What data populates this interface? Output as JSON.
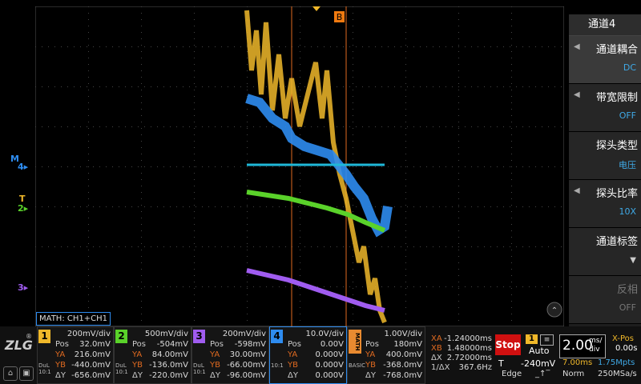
{
  "panel": {
    "title": "通道4",
    "items": [
      {
        "label": "通道耦合",
        "value": "DC",
        "selected": true
      },
      {
        "label": "带宽限制",
        "value": "OFF"
      },
      {
        "label": "探头类型",
        "value": "电压"
      },
      {
        "label": "探头比率",
        "value": "10X"
      },
      {
        "label": "通道标签",
        "value": ""
      },
      {
        "label": "反相",
        "value": "OFF",
        "dim": true
      }
    ]
  },
  "markers": {
    "cursor_b": "B",
    "math_label": "MATH: CH1+CH1",
    "ch1_mark": "1",
    "ch2_mark": "2",
    "ch3_mark": "3",
    "ch4_mark": "4",
    "m_mark": "M",
    "t_mark": "T"
  },
  "colors": {
    "ch1": "#f0b82a",
    "ch2": "#5ad22a",
    "ch3": "#a05cf0",
    "ch4": "#2e8cf0",
    "math": "#e88a30",
    "cursor": "#e06a20",
    "trigger": "#f0b82a"
  },
  "channels": [
    {
      "num": "1",
      "scale": "200mV/div",
      "pos": "32.0mV",
      "ya": "216.0mV",
      "yb": "-440.0mV",
      "dy": "-656.0mV",
      "color": "#f0b82a",
      "side": "DuL\n10:1"
    },
    {
      "num": "2",
      "scale": "500mV/div",
      "pos": "-504mV",
      "ya": "84.00mV",
      "yb": "-136.0mV",
      "dy": "-220.0mV",
      "color": "#5ad22a",
      "side": "DuL\n10:1"
    },
    {
      "num": "3",
      "scale": "200mV/div",
      "pos": "-598mV",
      "ya": "30.00mV",
      "yb": "-66.00mV",
      "dy": "-96.00mV",
      "color": "#a05cf0",
      "side": "DuL\n10:1"
    },
    {
      "num": "4",
      "scale": "10.0V/div",
      "pos": "0.00V",
      "ya": "0.000V",
      "yb": "0.000V",
      "dy": "0.000V",
      "color": "#2e8cf0",
      "side": "10:1"
    },
    {
      "num": "MATH",
      "scale": "1.00V/div",
      "pos": "180mV",
      "ya": "400.0mV",
      "yb": "-368.0mV",
      "dy": "-768.0mV",
      "color": "#e88a30",
      "side": "BASIC"
    }
  ],
  "labels": {
    "pos": "Pos",
    "ya": "YA",
    "yb": "YB",
    "dy": "ΔY"
  },
  "cursor_info": {
    "xa_k": "XA",
    "xa": "-1.24000ms",
    "xb_k": "XB",
    "xb": "1.48000ms",
    "dx_k": "ΔX",
    "dx": "2.72000ms",
    "inv_k": "1/ΔX",
    "inv": "367.6Hz"
  },
  "trigger": {
    "status": "Stop",
    "src": "1",
    "mode": "Auto",
    "level_k": "T",
    "level": "-240mV",
    "type": "Edge"
  },
  "timebase": {
    "scale": "2.00",
    "unit_top": "ms/",
    "unit_bottom": "div",
    "xpos_k": "X-Pos",
    "xpos": "0.00s",
    "mem": "7.00ms",
    "rate": "1.75Mpts",
    "acq": "Norm",
    "srate": "250MSa/s"
  },
  "logo": "ZLG"
}
